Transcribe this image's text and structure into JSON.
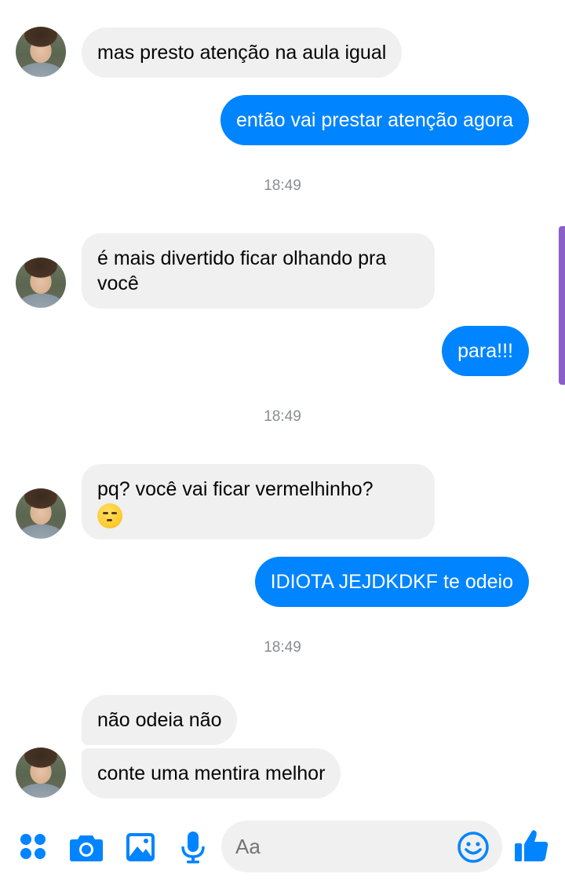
{
  "messages": [
    {
      "side": "in",
      "text": "mas presto atenção na aula igual"
    },
    {
      "side": "out",
      "text": "então vai prestar atenção agora"
    },
    {
      "side": "in",
      "text": "é mais divertido ficar olhando pra você"
    },
    {
      "side": "out",
      "text": "para!!!"
    },
    {
      "side": "in",
      "text": "pq? você vai ficar vermelhinho?",
      "emoji": "smirk-emoji"
    },
    {
      "side": "out",
      "text": "IDIOTA JEJDKDKF te odeio"
    },
    {
      "side": "in",
      "text": "não odeia não"
    },
    {
      "side": "in",
      "text": "conte uma mentira melhor"
    }
  ],
  "timestamps": [
    "18:49",
    "18:49",
    "18:49"
  ],
  "composer": {
    "placeholder": "Aa",
    "icons": [
      "grid-icon",
      "camera-icon",
      "image-icon",
      "microphone-icon",
      "emoji-icon",
      "like-icon"
    ]
  },
  "colors": {
    "accent": "#0084ff",
    "incoming_bubble": "#f0f0f0",
    "timestamp": "#8a8d91",
    "scroll_indicator": "#8b5fc8"
  }
}
